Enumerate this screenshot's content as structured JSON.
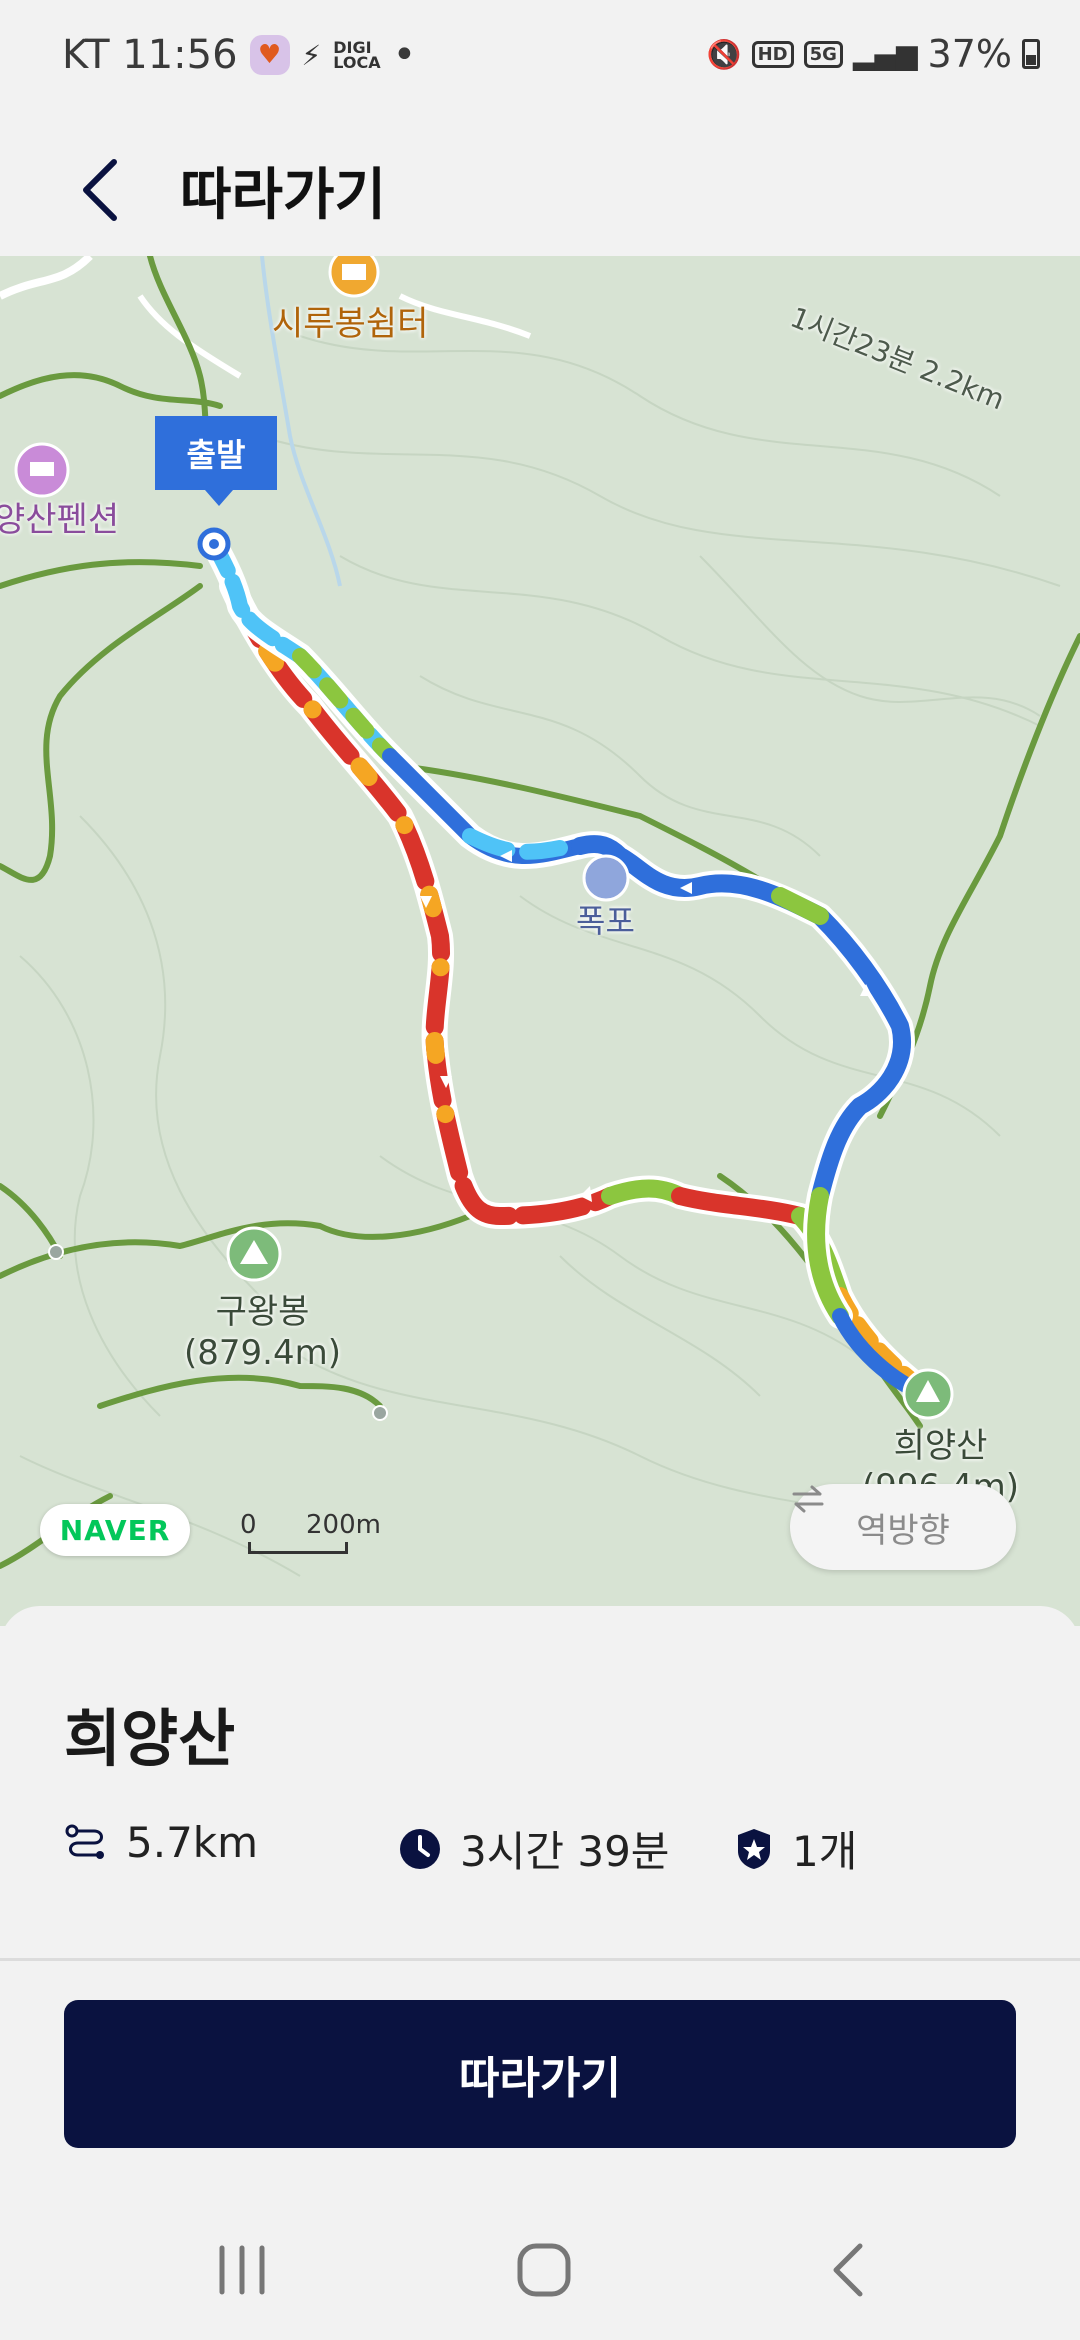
{
  "status_bar": {
    "carrier_time": "KT 11:56",
    "mini_text": "DIGI\nLOCA",
    "dot": "•",
    "network_badge": "HD",
    "network_type": "5G",
    "battery": "37%"
  },
  "header": {
    "title": "따라가기"
  },
  "map": {
    "labels": {
      "shelter": "시루봉쉼터",
      "pension": "양산펜션",
      "waterfall": "폭포",
      "peak1_name": "구왕봉",
      "peak1_elev": "(879.4m)",
      "peak2_name": "희양산",
      "peak2_elev": "(996.4m)",
      "trail_info": "1시간23분 2.2km"
    },
    "start_flag": "출발",
    "brand_logo": "NAVER",
    "scale_zero": "0",
    "scale_label": "200m",
    "reverse_button": "역방향",
    "colors": {
      "background": "#d7e3d3",
      "trail_line": "#6a9a3f",
      "route_blue": "#2f6fdb",
      "route_red": "#d9342b",
      "route_green": "#8cc63f",
      "route_orange": "#f5a623",
      "route_cyan": "#4fc3f7"
    }
  },
  "route": {
    "name": "희양산",
    "distance": "5.7km",
    "duration": "3시간 39분",
    "stamps": "1개"
  },
  "follow_button": "따라가기",
  "nav_icons": [
    "recent-apps-icon",
    "home-icon",
    "back-icon"
  ]
}
